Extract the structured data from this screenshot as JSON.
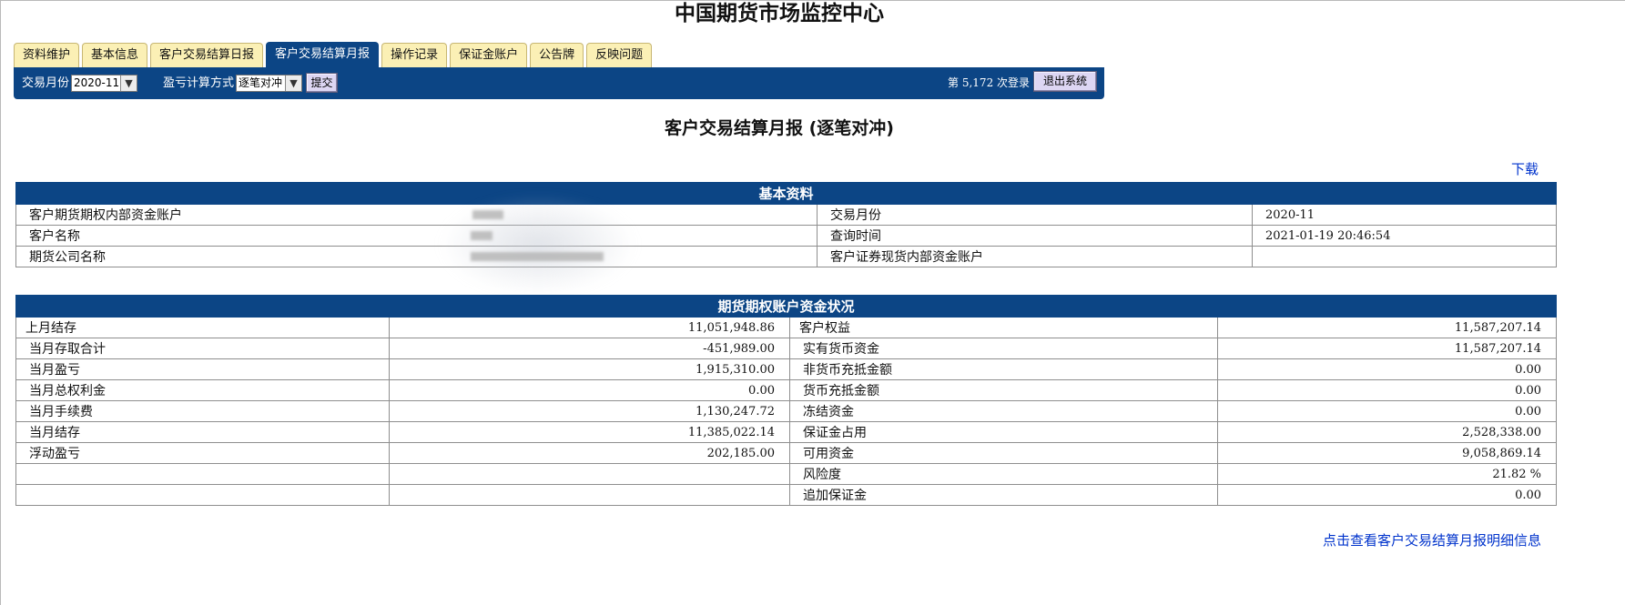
{
  "header": {
    "title": "中国期货市场监控中心"
  },
  "tabs": [
    {
      "label": "资料维护"
    },
    {
      "label": "基本信息"
    },
    {
      "label": "客户交易结算日报"
    },
    {
      "label": "客户交易结算月报",
      "active": true
    },
    {
      "label": "操作记录"
    },
    {
      "label": "保证金账户"
    },
    {
      "label": "公告牌"
    },
    {
      "label": "反映问题"
    }
  ],
  "toolbar": {
    "month_label": "交易月份",
    "month_value": "2020-11",
    "calc_label": "盈亏计算方式",
    "calc_value": "逐笔对冲",
    "submit_label": "提交",
    "login_prefix": "第",
    "login_count": "5,172",
    "login_suffix": "次登录",
    "logout_label": "退出系统"
  },
  "page_heading": "客户交易结算月报 (逐笔对冲)",
  "download_label": "下载",
  "basic": {
    "title": "基本资料",
    "rows": [
      {
        "label": "客户期货期权内部资金账户",
        "value": "",
        "label2": "交易月份",
        "value2": "2020-11"
      },
      {
        "label": "客户名称",
        "value": "",
        "label2": "查询时间",
        "value2": "2021-01-19 20:46:54"
      },
      {
        "label": "期货公司名称",
        "value": "",
        "label2": "客户证券现货内部资金账户",
        "value2": ""
      }
    ]
  },
  "funds": {
    "title": "期货期权账户资金状况",
    "rows": [
      {
        "l1": "上月结存",
        "v1": "11,051,948.86",
        "l2": "客户权益",
        "v2": "11,587,207.14"
      },
      {
        "l1": "当月存取合计",
        "v1": "-451,989.00",
        "l2": "实有货币资金",
        "v2": "11,587,207.14"
      },
      {
        "l1": "当月盈亏",
        "v1": "1,915,310.00",
        "l2": "非货币充抵金额",
        "v2": "0.00"
      },
      {
        "l1": "当月总权利金",
        "v1": "0.00",
        "l2": "货币充抵金额",
        "v2": "0.00"
      },
      {
        "l1": "当月手续费",
        "v1": "1,130,247.72",
        "l2": "冻结资金",
        "v2": "0.00"
      },
      {
        "l1": "当月结存",
        "v1": "11,385,022.14",
        "l2": "保证金占用",
        "v2": "2,528,338.00"
      },
      {
        "l1": "浮动盈亏",
        "v1": "202,185.00",
        "l2": "可用资金",
        "v2": "9,058,869.14"
      },
      {
        "l1": "",
        "v1": "",
        "l2": "风险度",
        "v2": "21.82 %"
      },
      {
        "l1": "",
        "v1": "",
        "l2": "追加保证金",
        "v2": "0.00"
      }
    ]
  },
  "detail_link": "点击查看客户交易结算月报明细信息"
}
